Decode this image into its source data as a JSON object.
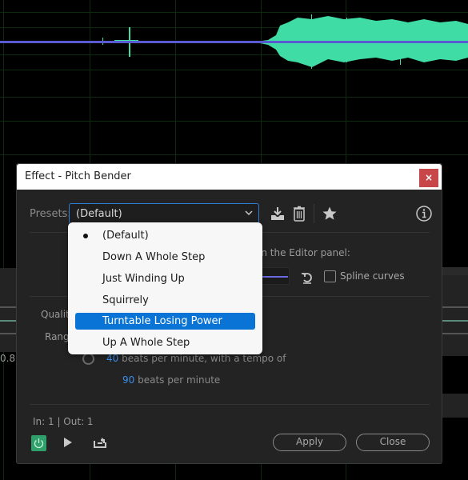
{
  "dialog": {
    "title": "Effect - Pitch Bender",
    "close_icon_label": "×",
    "presets_label": "Presets:",
    "presets_value": "(Default)",
    "toolbar_icons": [
      "download-preset-icon",
      "trash-icon",
      "star-icon",
      "info-icon"
    ],
    "editor_text": "in the Editor panel:",
    "spline_label": "Spline curves",
    "spline_checked": false,
    "quality_label": "Qualit",
    "range_label": "Range",
    "bpm": {
      "value1": "40",
      "text1": " beats per minute, with a tempo of",
      "value2": "90",
      "text2": " beats per minute"
    },
    "inout": "In: 1 | Out: 1",
    "apply_label": "Apply",
    "close_label": "Close"
  },
  "presets_menu": {
    "items": [
      {
        "label": "(Default)",
        "checked": true,
        "highlighted": false
      },
      {
        "label": "Down A Whole Step",
        "checked": false,
        "highlighted": false
      },
      {
        "label": "Just Winding Up",
        "checked": false,
        "highlighted": false
      },
      {
        "label": "Squirrely",
        "checked": false,
        "highlighted": false
      },
      {
        "label": "Turntable Losing Power",
        "checked": false,
        "highlighted": true
      },
      {
        "label": "Up A Whole Step",
        "checked": false,
        "highlighted": false
      }
    ]
  },
  "background": {
    "ruler_value": "0.8"
  },
  "colors": {
    "accent_blue": "#0a74d6",
    "waveform_green": "#3fdca6",
    "envelope_line": "#5a5ad0",
    "close_red": "#c8464a",
    "power_green": "#2fa06a"
  }
}
